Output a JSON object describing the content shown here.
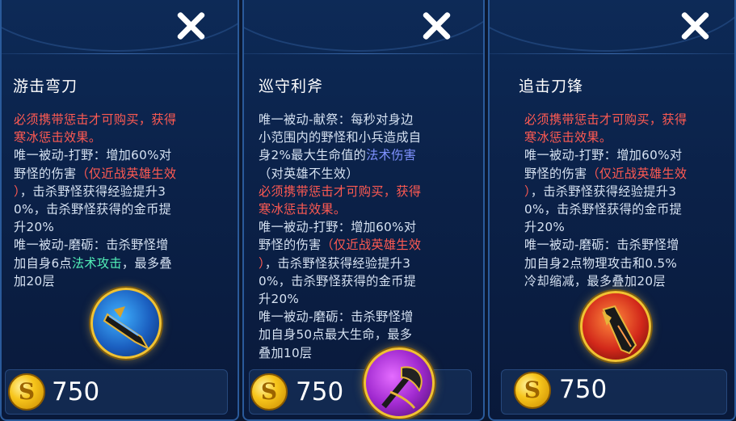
{
  "items": [
    {
      "name": "游击弯刀",
      "lines": [
        {
          "text": "必须携带惩击才可购买，获得",
          "color": "red"
        },
        {
          "text": "寒冰惩击效果。",
          "color": "red"
        },
        {
          "text": "唯一被动-打野：增加60%对",
          "color": "normal"
        },
        {
          "text": "野怪的伤害（仅近战英雄生效",
          "color": "mixed1"
        },
        {
          "text": "），击杀野怪获得经验提升3",
          "color": "mixed2"
        },
        {
          "text": "0%，击杀野怪获得的金币提",
          "color": "normal"
        },
        {
          "text": "升20%",
          "color": "normal"
        },
        {
          "text": "唯一被动-磨砺：击杀野怪增",
          "color": "normal"
        },
        {
          "text": "加自身6点法术攻击，最多叠",
          "color": "mixed3"
        },
        {
          "text": "加20层",
          "color": "normal"
        }
      ],
      "icon": "machete-icon",
      "price": "750"
    },
    {
      "name": "巡守利斧",
      "lines": [
        {
          "text": "唯一被动-献祭：每秒对身边",
          "color": "normal"
        },
        {
          "text": "小范围内的野怪和小兵造成自",
          "color": "normal"
        },
        {
          "text": "身2%最大生命值的法术伤害",
          "color": "mixed4"
        },
        {
          "text": "（对英雄不生效）",
          "color": "normal"
        },
        {
          "text": "必须携带惩击才可购买，获得",
          "color": "red"
        },
        {
          "text": "寒冰惩击效果。",
          "color": "red"
        },
        {
          "text": "唯一被动-打野：增加60%对",
          "color": "normal"
        },
        {
          "text": "野怪的伤害（仅近战英雄生效",
          "color": "mixed1"
        },
        {
          "text": "），击杀野怪获得经验提升3",
          "color": "mixed2"
        },
        {
          "text": "0%，击杀野怪获得的金币提",
          "color": "normal"
        },
        {
          "text": "升20%",
          "color": "normal"
        },
        {
          "text": "唯一被动-磨砺：击杀野怪增",
          "color": "normal"
        },
        {
          "text": "加自身50点最大生命，最多",
          "color": "normal"
        },
        {
          "text": "叠加10层",
          "color": "normal"
        }
      ],
      "icon": "axe-icon",
      "price": "750"
    },
    {
      "name": "追击刀锋",
      "lines": [
        {
          "text": "必须携带惩击才可购买，获得",
          "color": "red"
        },
        {
          "text": "寒冰惩击效果。",
          "color": "red"
        },
        {
          "text": "唯一被动-打野：增加60%对",
          "color": "normal"
        },
        {
          "text": "野怪的伤害（仅近战英雄生效",
          "color": "mixed1"
        },
        {
          "text": "），击杀野怪获得经验提升3",
          "color": "mixed2"
        },
        {
          "text": "0%，击杀野怪获得的金币提",
          "color": "normal"
        },
        {
          "text": "升20%",
          "color": "normal"
        },
        {
          "text": "唯一被动-磨砺：击杀野怪增",
          "color": "normal"
        },
        {
          "text": "加自身2点物理攻击和0.5%",
          "color": "normal"
        },
        {
          "text": "冷却缩减，最多叠加20层",
          "color": "normal"
        }
      ],
      "icon": "blade-icon",
      "price": "750"
    }
  ],
  "segments": {
    "p1_l4a": "野怪的伤害",
    "p1_l4b": "（仅近战英雄生效",
    "p1_l5a": "）",
    "p1_l5b": "，击杀野怪获得经验提升3",
    "p1_l9a": "加自身6点",
    "p1_l9b": "法术攻击",
    "p1_l9c": "，最多叠",
    "p2_l3a": "身2%最大生命值的",
    "p2_l3b": "法术伤害"
  },
  "colors": {
    "red": "#ff5a52",
    "green": "#52f0b8",
    "blue": "#7f92ff",
    "text": "#d6e2f2",
    "gold": "#f1c232"
  }
}
